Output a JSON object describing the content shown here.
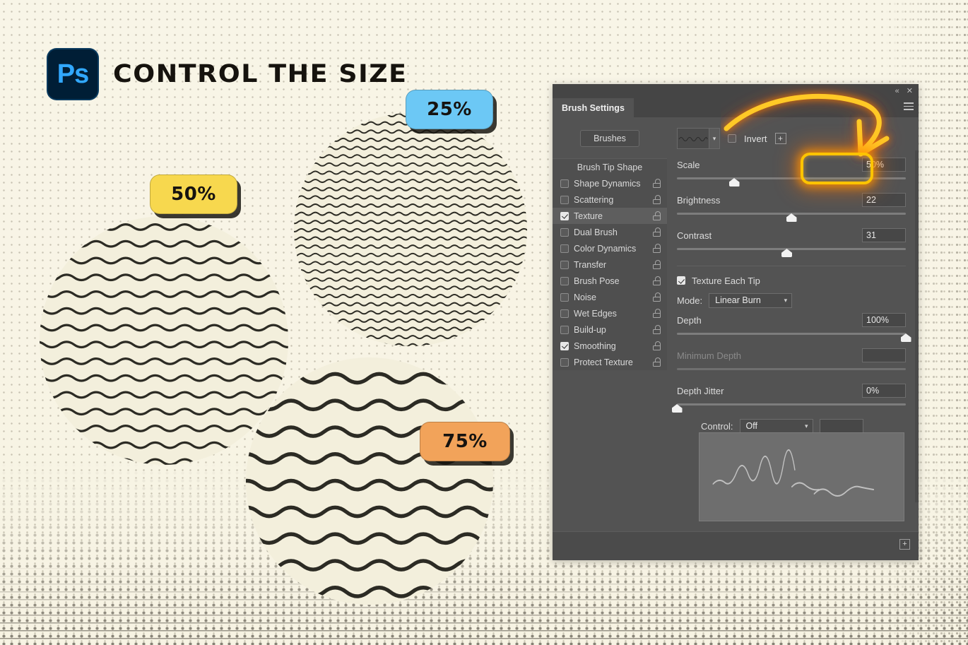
{
  "header": {
    "logo_text": "Ps",
    "logo_name": "photoshop-logo",
    "title": "CONTROL THE SIZE"
  },
  "samples": [
    {
      "label": "25%",
      "color": "#6cc8f5",
      "wave_amplitude": 4.5,
      "wave_period": 22,
      "wave_spacing": 13,
      "wave_thickness": 2.1
    },
    {
      "label": "50%",
      "color": "#f7d84e",
      "wave_amplitude": 8,
      "wave_period": 44,
      "wave_spacing": 25,
      "wave_thickness": 3.4
    },
    {
      "label": "75%",
      "color": "#f2a35a",
      "wave_amplitude": 13,
      "wave_period": 66,
      "wave_spacing": 40,
      "wave_thickness": 5.6
    }
  ],
  "panel": {
    "titlebar": {
      "collapse_icon": "«",
      "close_icon": "✕",
      "menu_icon": "hamburger-menu-icon"
    },
    "tab_label": "Brush Settings",
    "brushes_button": "Brushes",
    "option_list_header": "Brush Tip Shape",
    "options": [
      {
        "label": "Shape Dynamics",
        "checked": false,
        "selected": false
      },
      {
        "label": "Scattering",
        "checked": false,
        "selected": false
      },
      {
        "label": "Texture",
        "checked": true,
        "selected": true
      },
      {
        "label": "Dual Brush",
        "checked": false,
        "selected": false
      },
      {
        "label": "Color Dynamics",
        "checked": false,
        "selected": false
      },
      {
        "label": "Transfer",
        "checked": false,
        "selected": false
      },
      {
        "label": "Brush Pose",
        "checked": false,
        "selected": false
      },
      {
        "label": "Noise",
        "checked": false,
        "selected": false
      },
      {
        "label": "Wet Edges",
        "checked": false,
        "selected": false
      },
      {
        "label": "Build-up",
        "checked": false,
        "selected": false
      },
      {
        "label": "Smoothing",
        "checked": true,
        "selected": false
      },
      {
        "label": "Protect Texture",
        "checked": false,
        "selected": false
      }
    ],
    "invert_label": "Invert",
    "invert_checked": false,
    "add_preset_icon": "+",
    "controls": {
      "scale": {
        "label": "Scale",
        "value": "50%",
        "slider_pct": 25,
        "enabled": true
      },
      "brightness": {
        "label": "Brightness",
        "value": "22",
        "slider_pct": 50,
        "enabled": true
      },
      "contrast": {
        "label": "Contrast",
        "value": "31",
        "slider_pct": 48,
        "enabled": true
      },
      "depth": {
        "label": "Depth",
        "value": "100%",
        "slider_pct": 100,
        "enabled": true
      },
      "minimum_depth": {
        "label": "Minimum Depth",
        "value": "",
        "slider_pct": 0,
        "enabled": false
      },
      "depth_jitter": {
        "label": "Depth Jitter",
        "value": "0%",
        "slider_pct": 0,
        "enabled": true
      }
    },
    "texture_each_tip": {
      "label": "Texture Each Tip",
      "checked": true
    },
    "mode": {
      "label": "Mode:",
      "value": "Linear Burn"
    },
    "control": {
      "label": "Control:",
      "value": "Off"
    },
    "footer_plus_icon": "+"
  },
  "annotation": {
    "highlight_color": "#ffc400",
    "glow_color": "#ff7a00",
    "target": "scale-value-field",
    "arrow_name": "pointer-arrow"
  },
  "theme": {
    "paper": "#f7f4e6",
    "panel_bg": "#535353",
    "panel_chrome": "#454545",
    "text": "#d6d6d6",
    "ps_blue": "#31a8ff",
    "ps_navy": "#001e36"
  }
}
